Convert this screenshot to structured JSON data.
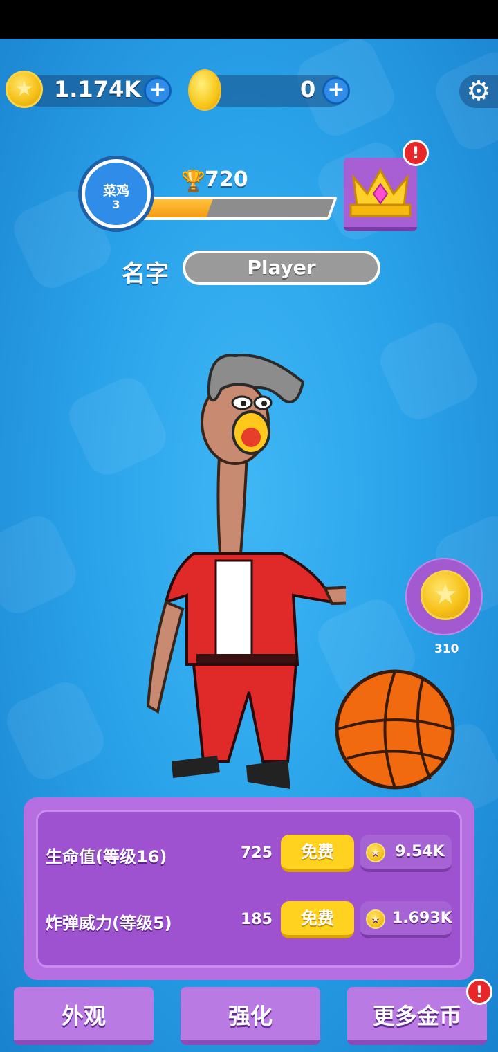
{
  "currency": {
    "coins": "1.174K",
    "gems": "0",
    "coin_icon": "star-coin-icon",
    "gem_icon": "golden-egg-icon",
    "add_icon": "plus-icon"
  },
  "settings": {
    "icon": "gear-icon"
  },
  "player": {
    "rank_title": "菜鸡",
    "rank_level": "3",
    "trophies": "720",
    "trophy_icon": "trophy-icon",
    "rank_progress": 0.37,
    "name_label": "名字",
    "name": "Player"
  },
  "crown": {
    "icon": "crown-icon",
    "alert": "!"
  },
  "bonus": {
    "count": "310",
    "icon": "star-coin-icon"
  },
  "upgrades": [
    {
      "label": "生命值(等级16)",
      "value": "725",
      "free_label": "免费",
      "cost": "9.54K"
    },
    {
      "label": "炸弹威力(等级5)",
      "value": "185",
      "free_label": "免费",
      "cost": "1.693K"
    }
  ],
  "bottom_nav": {
    "appearance": "外观",
    "upgrade": "强化",
    "more_coins": "更多金币",
    "more_coins_alert": "!"
  },
  "colors": {
    "background": "#2aa3ea",
    "panel": "#b56fe0",
    "button_yellow": "#ffd21f",
    "progress_fill": "#f59a12",
    "alert_red": "#e8262a"
  }
}
